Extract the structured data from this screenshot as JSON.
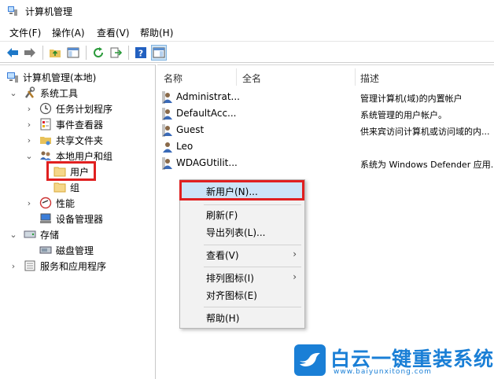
{
  "window": {
    "title": "计算机管理"
  },
  "menu": [
    "文件(F)",
    "操作(A)",
    "查看(V)",
    "帮助(H)"
  ],
  "toolbar": {
    "icons": [
      "back-arrow-icon",
      "forward-arrow-icon",
      "up-folder-icon",
      "show-hide-tree-icon",
      "refresh-icon",
      "export-list-icon",
      "help-icon",
      "show-console-tree-icon"
    ]
  },
  "tree": {
    "root": "计算机管理(本地)",
    "system_tools": "系统工具",
    "task_scheduler": "任务计划程序",
    "event_viewer": "事件查看器",
    "shared_folders": "共享文件夹",
    "local_users_groups": "本地用户和组",
    "users": "用户",
    "groups": "组",
    "performance": "性能",
    "device_manager": "设备管理器",
    "storage": "存储",
    "disk_management": "磁盘管理",
    "services_apps": "服务和应用程序"
  },
  "columns": {
    "name": "名称",
    "fullname": "全名",
    "description": "描述"
  },
  "users": [
    {
      "name": "Administrat...",
      "description": "管理计算机(域)的内置帐户"
    },
    {
      "name": "DefaultAcc...",
      "description": "系统管理的用户帐户。"
    },
    {
      "name": "Guest",
      "description": "供来宾访问计算机或访问域的内..."
    },
    {
      "name": "Leo",
      "description": ""
    },
    {
      "name": "WDAGUtilit...",
      "description": "系统为 Windows Defender 应用..."
    }
  ],
  "context_menu": {
    "new_user": "新用户(N)...",
    "refresh": "刷新(F)",
    "export_list": "导出列表(L)...",
    "view": "查看(V)",
    "arrange_icons": "排列图标(I)",
    "align_icons": "对齐图标(E)",
    "help": "帮助(H)",
    "submenu_arrow": "›"
  },
  "watermark": {
    "title": "白云一键重装系统",
    "url": "www.baiyunxitong.com"
  },
  "colors": {
    "highlight_red": "#e02020",
    "brand_blue": "#1a7fd6",
    "menu_hover": "#cce4f7"
  }
}
